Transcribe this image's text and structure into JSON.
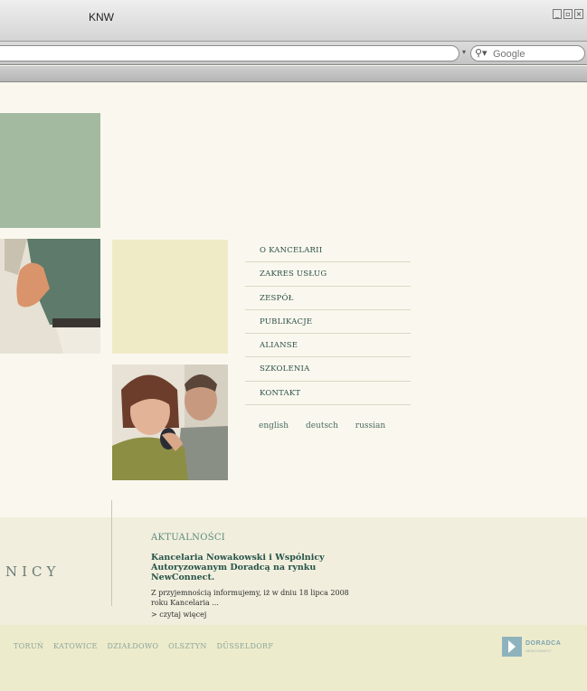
{
  "window": {
    "title": "KNW"
  },
  "browser": {
    "search_placeholder": "Google"
  },
  "nav": {
    "items": [
      {
        "label": "O KANCELARII"
      },
      {
        "label": "ZAKRES USŁUG"
      },
      {
        "label": "ZESPÓŁ"
      },
      {
        "label": "PUBLIKACJE"
      },
      {
        "label": "ALIANSE"
      },
      {
        "label": "SZKOLENIA"
      },
      {
        "label": "KONTAKT"
      }
    ],
    "languages": [
      "english",
      "deutsch",
      "russian"
    ]
  },
  "logo": {
    "text_visible": "NICY"
  },
  "news": {
    "heading": "AKTUALNOŚCI",
    "title": "Kancelaria Nowakowski i Wspólnicy Autoryzowanym Doradcą na rynku NewConnect.",
    "body": "Z przyjemnością informujemy, iż w dniu 18 lipca 2008 roku Kancelaria ...",
    "more": "> czytaj więcej"
  },
  "cities": [
    "TORUŃ",
    "KATOWICE",
    "DZIAŁDOWO",
    "OLSZTYN",
    "DÜSSELDORF"
  ],
  "badge": {
    "title": "DORADCA",
    "sub": "NEWCONNECT"
  },
  "colors": {
    "page_bg": "#faf8ee",
    "green_block": "#a3b9a0",
    "yellow_block": "#efebc7",
    "nav_text": "#2b4e45",
    "city_band": "#ecebcb"
  }
}
